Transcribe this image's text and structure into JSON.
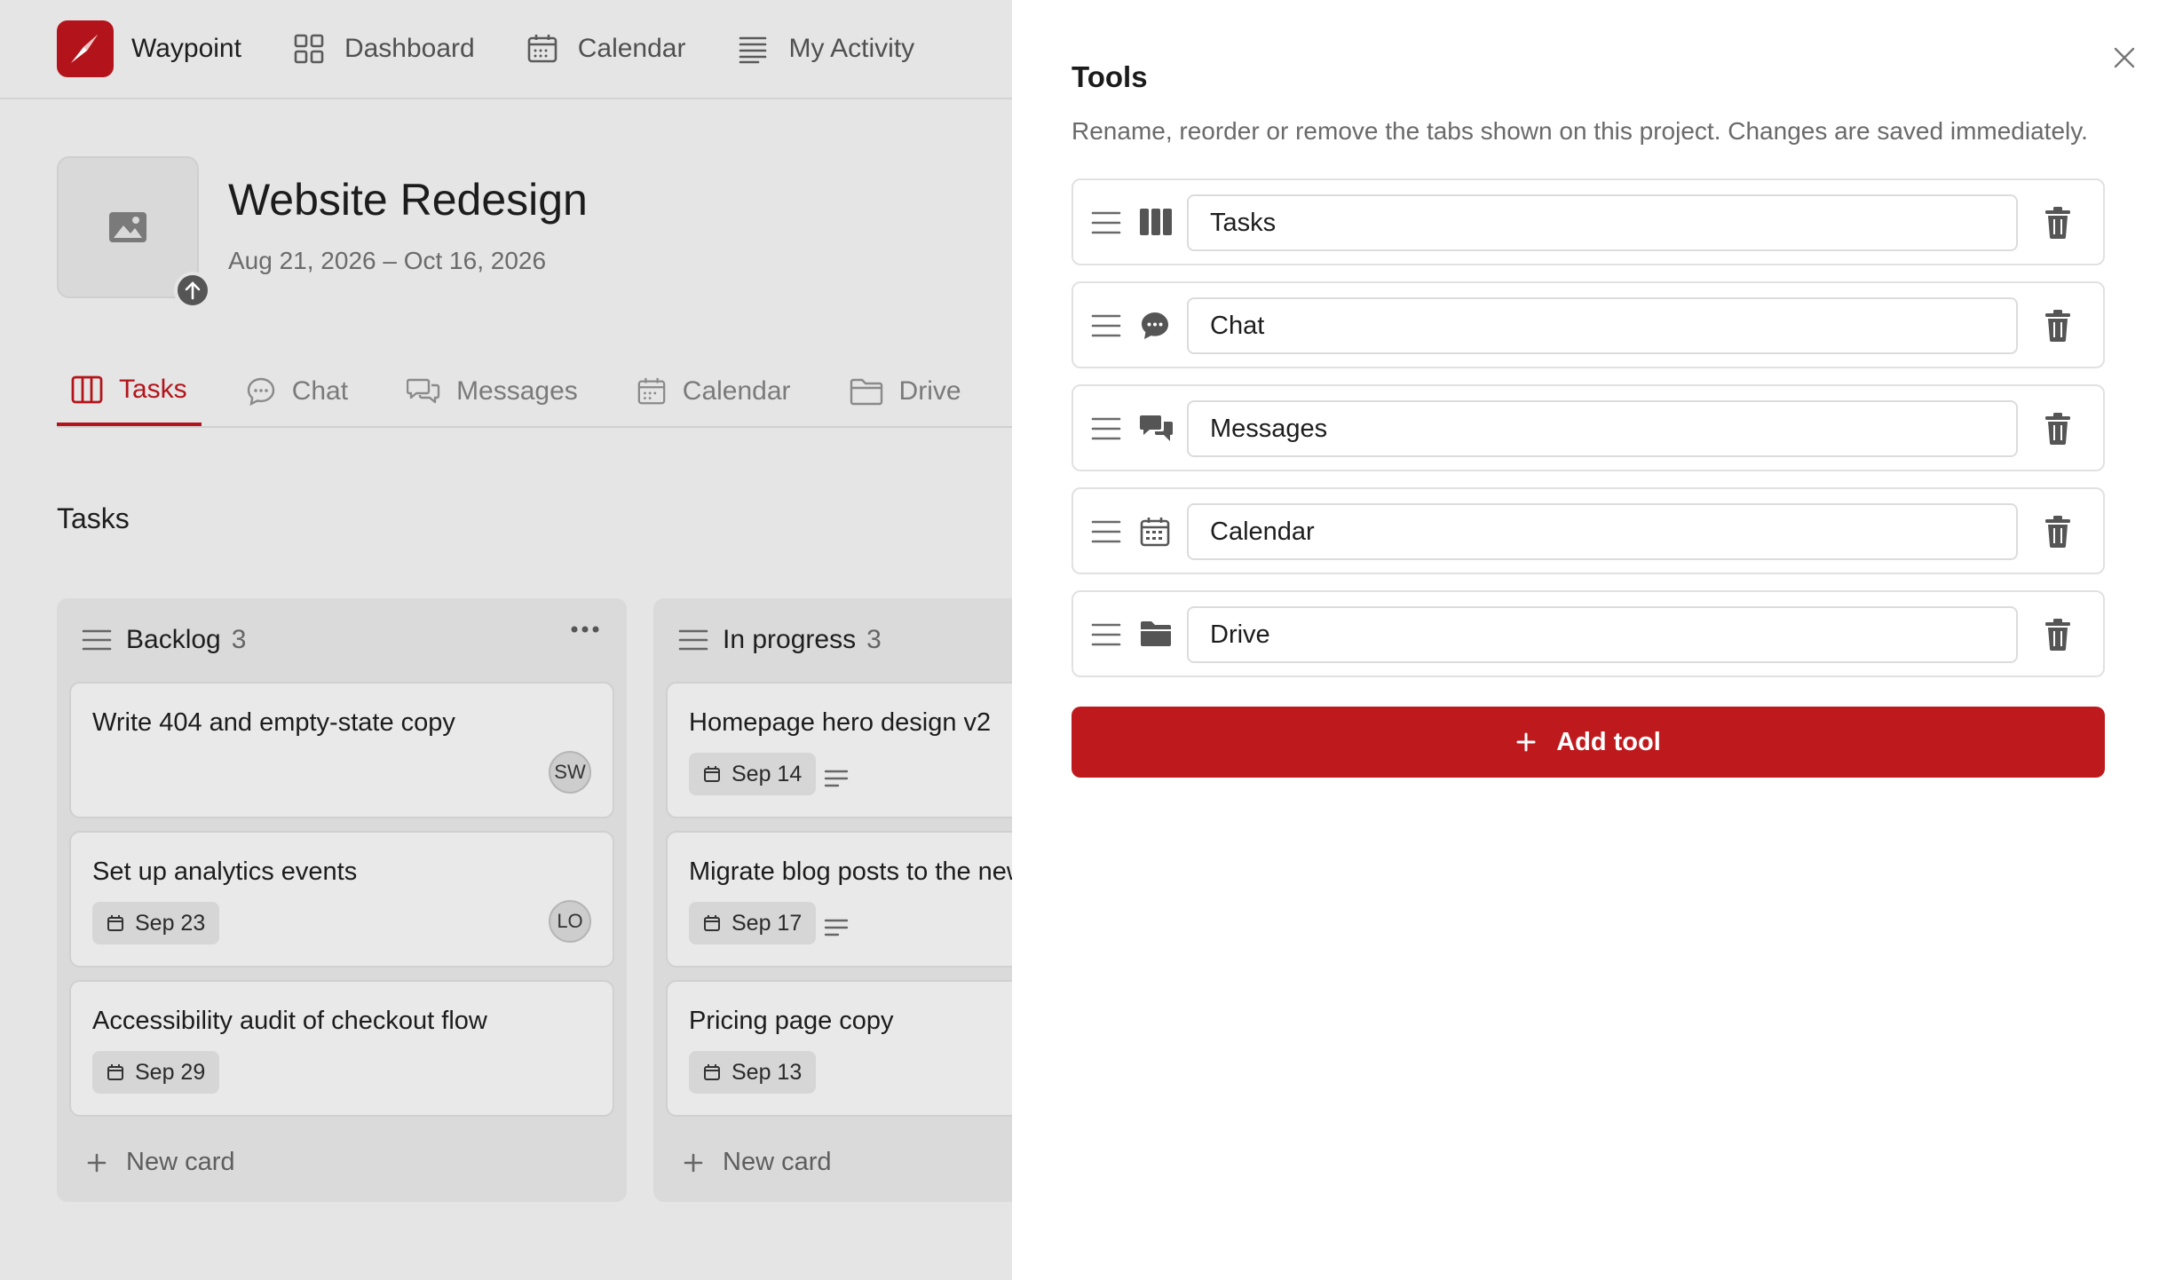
{
  "app": {
    "brand": "Waypoint",
    "nav": [
      {
        "label": "Dashboard",
        "icon": "grid-icon"
      },
      {
        "label": "Calendar",
        "icon": "calendar-icon"
      },
      {
        "label": "My Activity",
        "icon": "activity-list-icon"
      }
    ]
  },
  "project": {
    "title": "Website Redesign",
    "dates": "Aug 21, 2026 – Oct 16, 2026"
  },
  "tabs": [
    {
      "label": "Tasks",
      "icon": "board-icon",
      "active": true
    },
    {
      "label": "Chat",
      "icon": "chat-icon"
    },
    {
      "label": "Messages",
      "icon": "messages-icon"
    },
    {
      "label": "Calendar",
      "icon": "calendar-icon"
    },
    {
      "label": "Drive",
      "icon": "folder-icon"
    }
  ],
  "board": {
    "title": "Tasks",
    "columns": [
      {
        "name": "Backlog",
        "count": "3",
        "cards": [
          {
            "title": "Write 404 and empty-state copy",
            "date": "",
            "assignee": "SW"
          },
          {
            "title": "Set up analytics events",
            "date": "Sep 23",
            "assignee": "LO"
          },
          {
            "title": "Accessibility audit of checkout flow",
            "date": "Sep 29",
            "assignee": ""
          }
        ],
        "new_card": "New card"
      },
      {
        "name": "In progress",
        "count": "3",
        "cards": [
          {
            "title": "Homepage hero design v2",
            "date": "Sep 14",
            "has_description": true
          },
          {
            "title": "Migrate blog posts to the new CMS",
            "date": "Sep 17",
            "has_description": true
          },
          {
            "title": "Pricing page copy",
            "date": "Sep 13",
            "has_description": false
          }
        ],
        "new_card": "New card"
      }
    ]
  },
  "drawer": {
    "title": "Tools",
    "description": "Rename, reorder or remove the tabs shown on this project. Changes are saved immediately.",
    "tools": [
      {
        "name": "Tasks",
        "icon": "board-icon"
      },
      {
        "name": "Chat",
        "icon": "chat-icon"
      },
      {
        "name": "Messages",
        "icon": "messages-icon"
      },
      {
        "name": "Calendar",
        "icon": "calendar-icon"
      },
      {
        "name": "Drive",
        "icon": "folder-icon"
      }
    ],
    "add_label": "Add tool"
  },
  "colors": {
    "accent": "#b3141b",
    "button": "#be1a1e"
  }
}
